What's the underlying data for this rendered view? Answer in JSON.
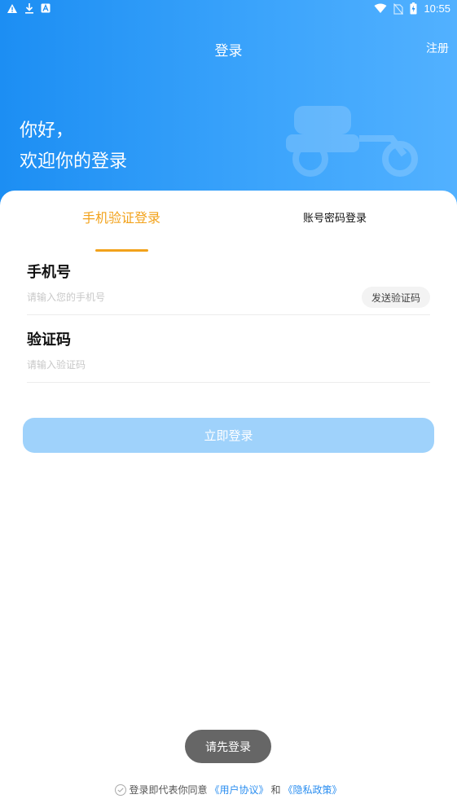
{
  "status_bar": {
    "time": "10:55",
    "left_icons": [
      "warning-icon",
      "download-icon",
      "app-a-icon"
    ],
    "right_icons": [
      "wifi-icon",
      "no-sim-icon",
      "battery-charging-icon"
    ]
  },
  "nav": {
    "title": "登录",
    "register_label": "注册"
  },
  "greeting": {
    "line1": "你好，",
    "line2": "欢迎你的登录"
  },
  "tabs": [
    {
      "label": "手机验证登录",
      "active": true
    },
    {
      "label": "账号密码登录",
      "active": false
    }
  ],
  "form": {
    "phone_label": "手机号",
    "phone_placeholder": "请输入您的手机号",
    "phone_value": "",
    "send_code_label": "发送验证码",
    "code_label": "验证码",
    "code_placeholder": "请输入验证码",
    "code_value": ""
  },
  "login_button": "立即登录",
  "toast": "请先登录",
  "agreement": {
    "prefix": "登录即代表你同意",
    "user_agreement": "《用户协议》",
    "and": "和",
    "privacy_policy": "《隐私政策》"
  },
  "colors": {
    "header_gradient_start": "#1c8ef3",
    "header_gradient_end": "#52b1ff",
    "accent_orange": "#f2a21b",
    "button_disabled": "#9fd2fb",
    "link_blue": "#2a8ef0"
  }
}
